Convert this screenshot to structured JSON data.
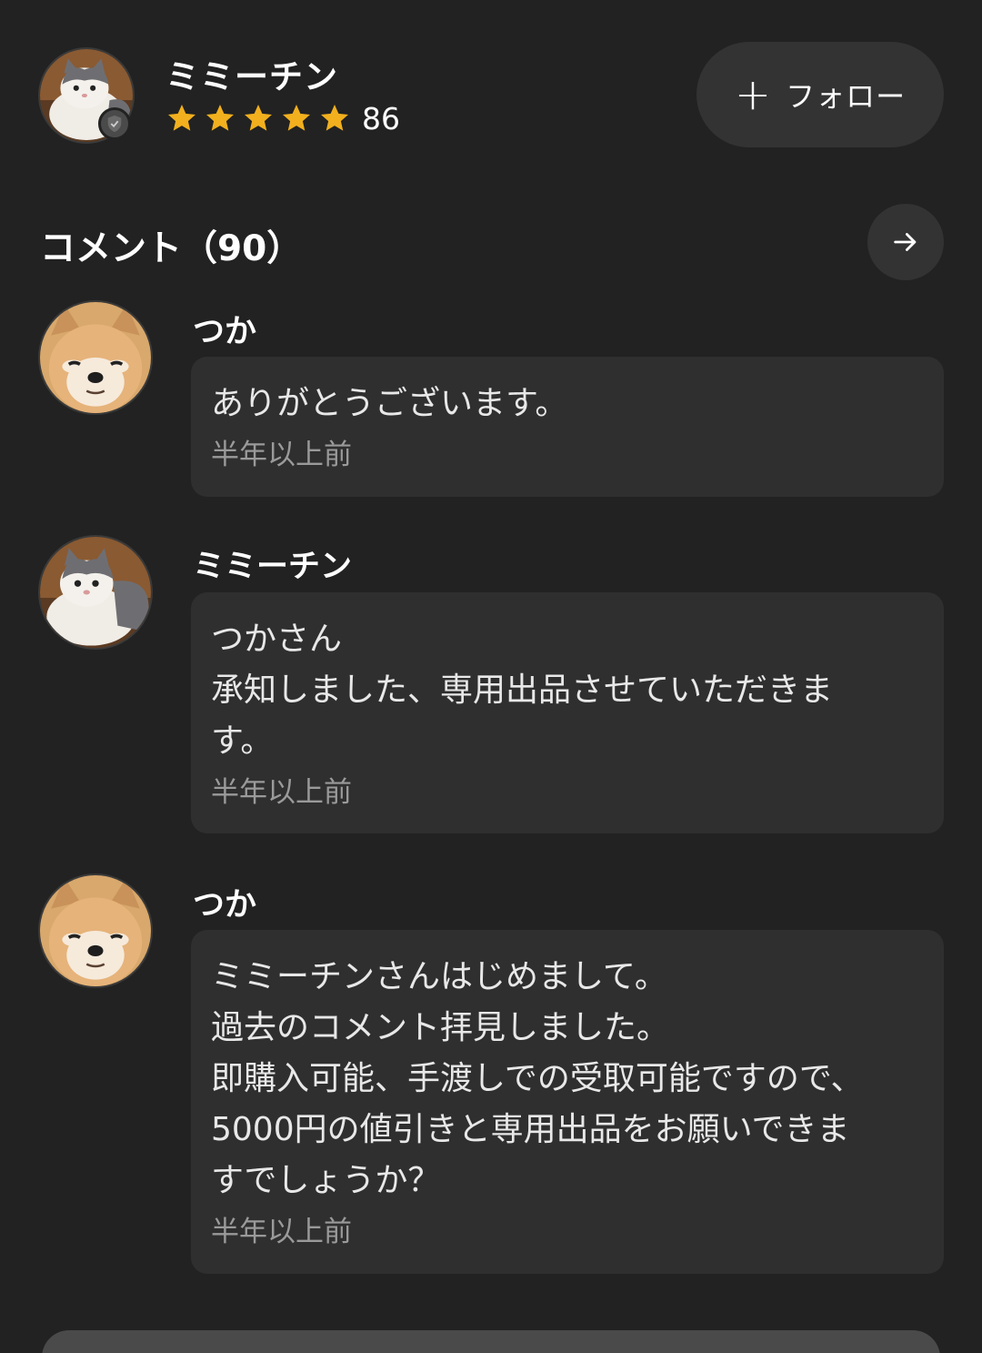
{
  "seller": {
    "name": "ミミーチン",
    "avatar_icon": "cat-avatar-icon",
    "verified_icon": "verified-shield-icon",
    "rating_stars": 5,
    "rating_count": "86",
    "star_color": "#f2b01e"
  },
  "follow_button": {
    "plus": "+",
    "label": "フォロー"
  },
  "comments_section": {
    "title": "コメント（90）",
    "arrow_icon": "arrow-right-icon"
  },
  "comments": [
    {
      "author": "つか",
      "avatar_icon": "shiba-dog-avatar-icon",
      "text": "ありがとうございます。",
      "time": "半年以上前"
    },
    {
      "author": "ミミーチン",
      "avatar_icon": "cat-avatar-icon",
      "text": "つかさん\n承知しました、専用出品させていただきま\nす。",
      "time": "半年以上前"
    },
    {
      "author": "つか",
      "avatar_icon": "shiba-dog-avatar-icon",
      "text": "ミミーチンさんはじめまして。\n過去のコメント拝見しました。\n即購入可能、手渡しでの受取可能ですので、\n5000円の値引きと専用出品をお願いできま\nすでしょうか？",
      "time": "半年以上前"
    }
  ],
  "colors": {
    "background": "#222222",
    "bubble": "#2f2f2f",
    "button": "#333333",
    "muted_text": "#9a9a9a"
  }
}
